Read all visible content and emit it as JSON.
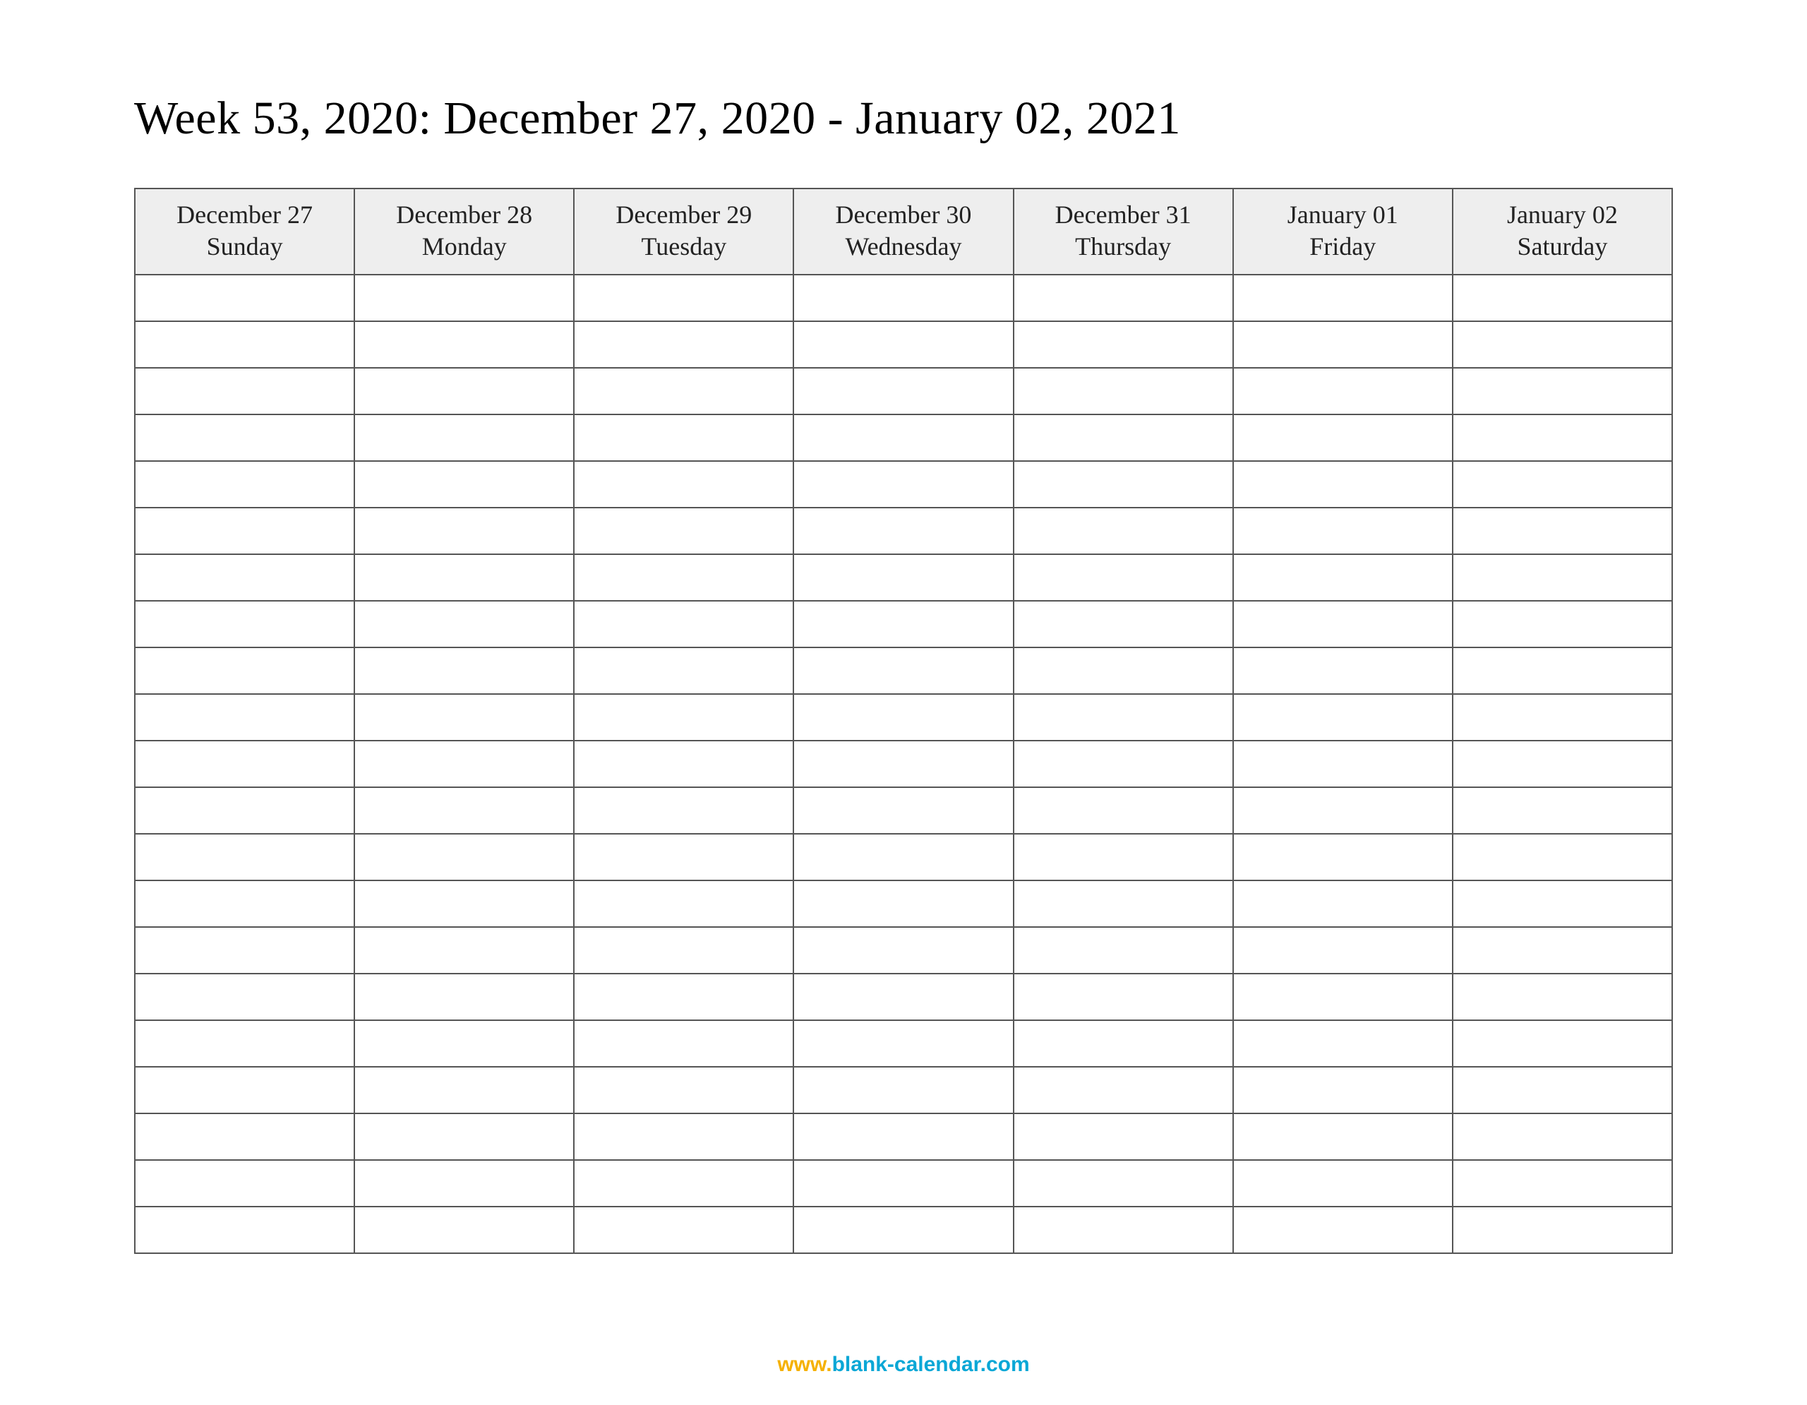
{
  "title": "Week 53, 2020: December 27, 2020 - January 02, 2021",
  "columns": [
    {
      "date": "December 27",
      "dow": "Sunday"
    },
    {
      "date": "December 28",
      "dow": "Monday"
    },
    {
      "date": "December 29",
      "dow": "Tuesday"
    },
    {
      "date": "December 30",
      "dow": "Wednesday"
    },
    {
      "date": "December 31",
      "dow": "Thursday"
    },
    {
      "date": "January 01",
      "dow": "Friday"
    },
    {
      "date": "January 02",
      "dow": "Saturday"
    }
  ],
  "row_count": 21,
  "footer": {
    "www": "www.",
    "domain": "blank-calendar.com"
  }
}
